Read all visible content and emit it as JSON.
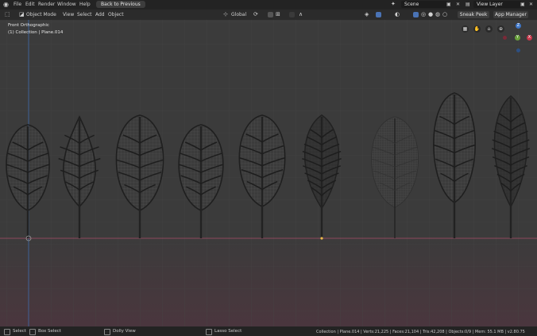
{
  "topbar": {
    "menus": [
      "File",
      "Edit",
      "Render",
      "Window",
      "Help"
    ],
    "back_button": "Back to Previous",
    "scene_label": "Scene",
    "view_layer_label": "View Layer"
  },
  "header": {
    "mode": "Object Mode",
    "menus": [
      "View",
      "Select",
      "Add",
      "Object"
    ],
    "orientation": "Global",
    "sneak_peek": "Sneak Peek",
    "app_manager": "App Manager"
  },
  "viewport": {
    "view_name": "Front Orthographic",
    "collection_line": "(1) Collection | Plane.014",
    "gizmo_axes": [
      "Z",
      "X",
      "Y"
    ]
  },
  "leaves": [
    {
      "type": "round"
    },
    {
      "type": "pointed"
    },
    {
      "type": "round"
    },
    {
      "type": "round"
    },
    {
      "type": "round"
    },
    {
      "type": "serrated"
    },
    {
      "type": "faint"
    },
    {
      "type": "tall"
    },
    {
      "type": "serrated"
    }
  ],
  "statusbar": {
    "select": "Select",
    "box_select": "Box Select",
    "dolly_view": "Dolly View",
    "lasso_select": "Lasso Select",
    "stats": "Collection | Plane.014 | Verts:21,225 | Faces:21,104 | Tris:42,208 | Objects:0/9 | Mem: 55.1 MB | v2.80.75"
  },
  "colors": {
    "axis_x": "#c8374b",
    "axis_y": "#6aa13c",
    "axis_z": "#3f77c8",
    "floor_line": "#a8506a"
  }
}
